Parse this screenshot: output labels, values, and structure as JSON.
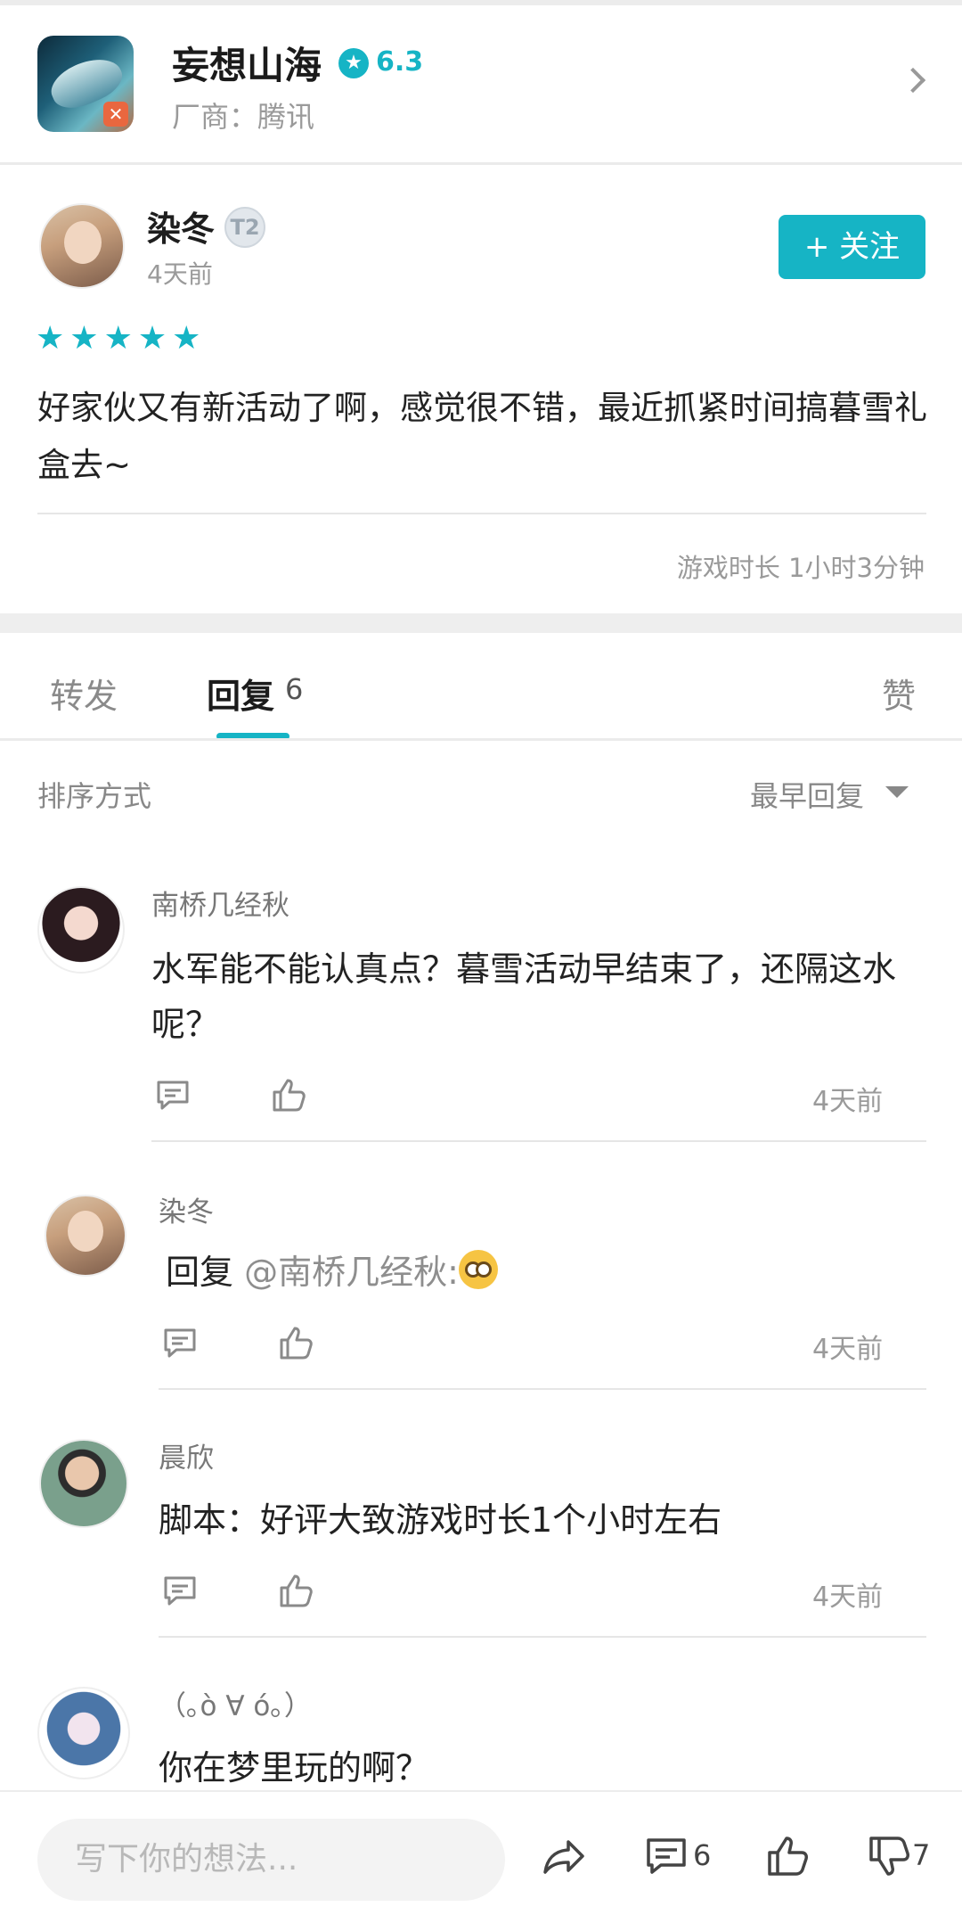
{
  "game": {
    "title": "妄想山海",
    "score": "6.3",
    "vendor": "厂商：腾讯"
  },
  "review": {
    "author": "染冬",
    "level": "T2",
    "time": "4天前",
    "follow_label": "+ 关注",
    "rating_stars": 5,
    "text": "好家伙又有新活动了啊，感觉很不错，最近抓紧时间搞暮雪礼盒去~",
    "playtime": "游戏时长 1小时3分钟"
  },
  "tabs": {
    "forward": "转发",
    "reply": "回复",
    "reply_count": "6",
    "like": "赞"
  },
  "sort": {
    "label": "排序方式",
    "value": "最早回复"
  },
  "comments": [
    {
      "name": "南桥几经秋",
      "text": "水军能不能认真点？暮雪活动早结束了，还隔这水呢？",
      "time": "4天前"
    },
    {
      "name": "染冬",
      "reply_prefix": "回复",
      "mention": "@南桥几经秋:",
      "time": "4天前"
    },
    {
      "name": "晨欣",
      "text": "脚本：好评大致游戏时长1个小时左右",
      "time": "4天前"
    },
    {
      "name": "（｡ò ∀ ó｡）",
      "text": "你在梦里玩的啊？"
    }
  ],
  "bottom_bar": {
    "input_placeholder": "写下你的想法...",
    "comment_count": "6",
    "dislike_count": "7"
  },
  "colors": {
    "accent": "#16b4c5",
    "text_primary": "#222222",
    "text_secondary": "#9a9a9a"
  }
}
